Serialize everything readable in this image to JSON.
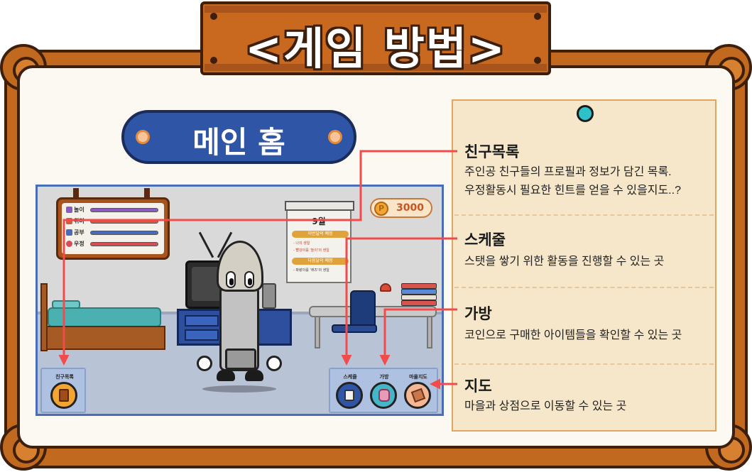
{
  "title": "<게임 방법>",
  "section_label": "메인 홈",
  "game_screen": {
    "stats": [
      {
        "label": "놀이",
        "color": "#8b5cc0"
      },
      {
        "label": "취미",
        "color": "#e0553c"
      },
      {
        "label": "공부",
        "color": "#4a6bb8"
      },
      {
        "label": "우정",
        "color": "#d64d57"
      }
    ],
    "coin_symbol": "P",
    "coin_amount": "3000",
    "calendar": {
      "month": "9월",
      "tag1": "이번달의 예정",
      "line1": "- 나의 생일",
      "line2": "- 빨강이를 '놀이'의 생일",
      "tag2": "다음달의 예정",
      "line3": "- 파랑이를 '퀴즈'의 생일"
    },
    "menu": {
      "friends_label": "친구목록",
      "schedule_label": "스케줄",
      "bag_label": "가방",
      "map_label": "마을지도"
    }
  },
  "info": [
    {
      "title": "친구목록",
      "desc": "주인공 친구들의 프로필과 정보가 담긴 목록.\n우정활동시 필요한 힌트를 얻을 수 있을지도..?"
    },
    {
      "title": "스케줄",
      "desc": "스탯을 쌓기 위한 활동을 진행할 수 있는 곳"
    },
    {
      "title": "가방",
      "desc": "코인으로 구매한 아이템들을 확인할 수 있는 곳"
    },
    {
      "title": "지도",
      "desc": "마을과 상점으로 이동할 수 있는 곳"
    }
  ],
  "colors": {
    "wood": "#c1691f",
    "outline": "#3d1f0b",
    "pill_blue": "#2f56a6",
    "note_bg": "#f6e7cb",
    "callout_red": "#f24b4b",
    "pin_teal": "#2fc1c9"
  }
}
